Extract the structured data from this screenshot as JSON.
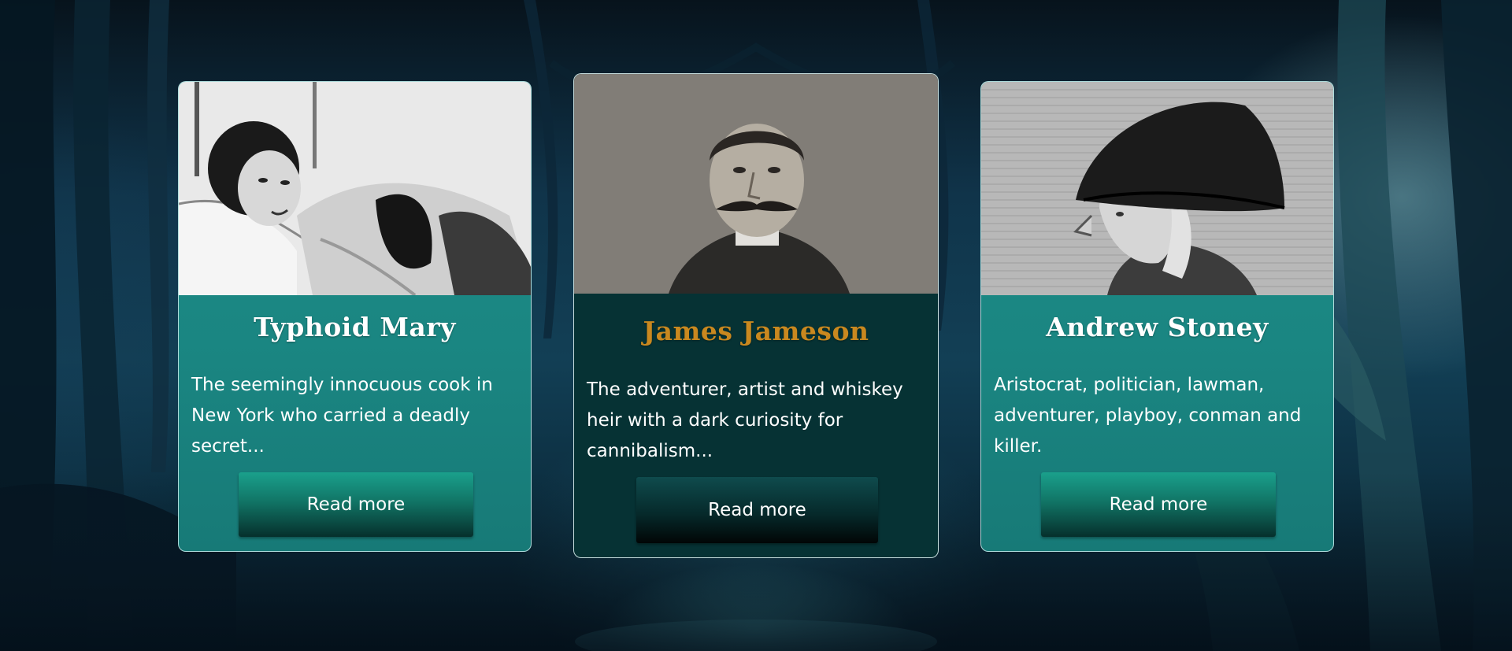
{
  "cards": [
    {
      "name": "Typhoid Mary",
      "description": "The seemingly innocuous cook in New York who carried a deadly secret...",
      "button_label": "Read more",
      "photo_icon": "portrait-photo-woman-in-bed"
    },
    {
      "name": "James Jameson",
      "description": "The adventurer, artist and whiskey heir with a dark curiosity for cannibalism...",
      "button_label": "Read more",
      "photo_icon": "portrait-photo-man-with-moustache"
    },
    {
      "name": "Andrew Stoney",
      "description": "Aristocrat, politician, lawman, adventurer, playboy, conman and killer.",
      "button_label": "Read more",
      "photo_icon": "engraving-man-in-bicorne-hat"
    }
  ],
  "colors": {
    "card_teal": "#1c8a86",
    "card_featured": "#063234",
    "featured_title": "#c9881f",
    "text": "#ffffff"
  }
}
